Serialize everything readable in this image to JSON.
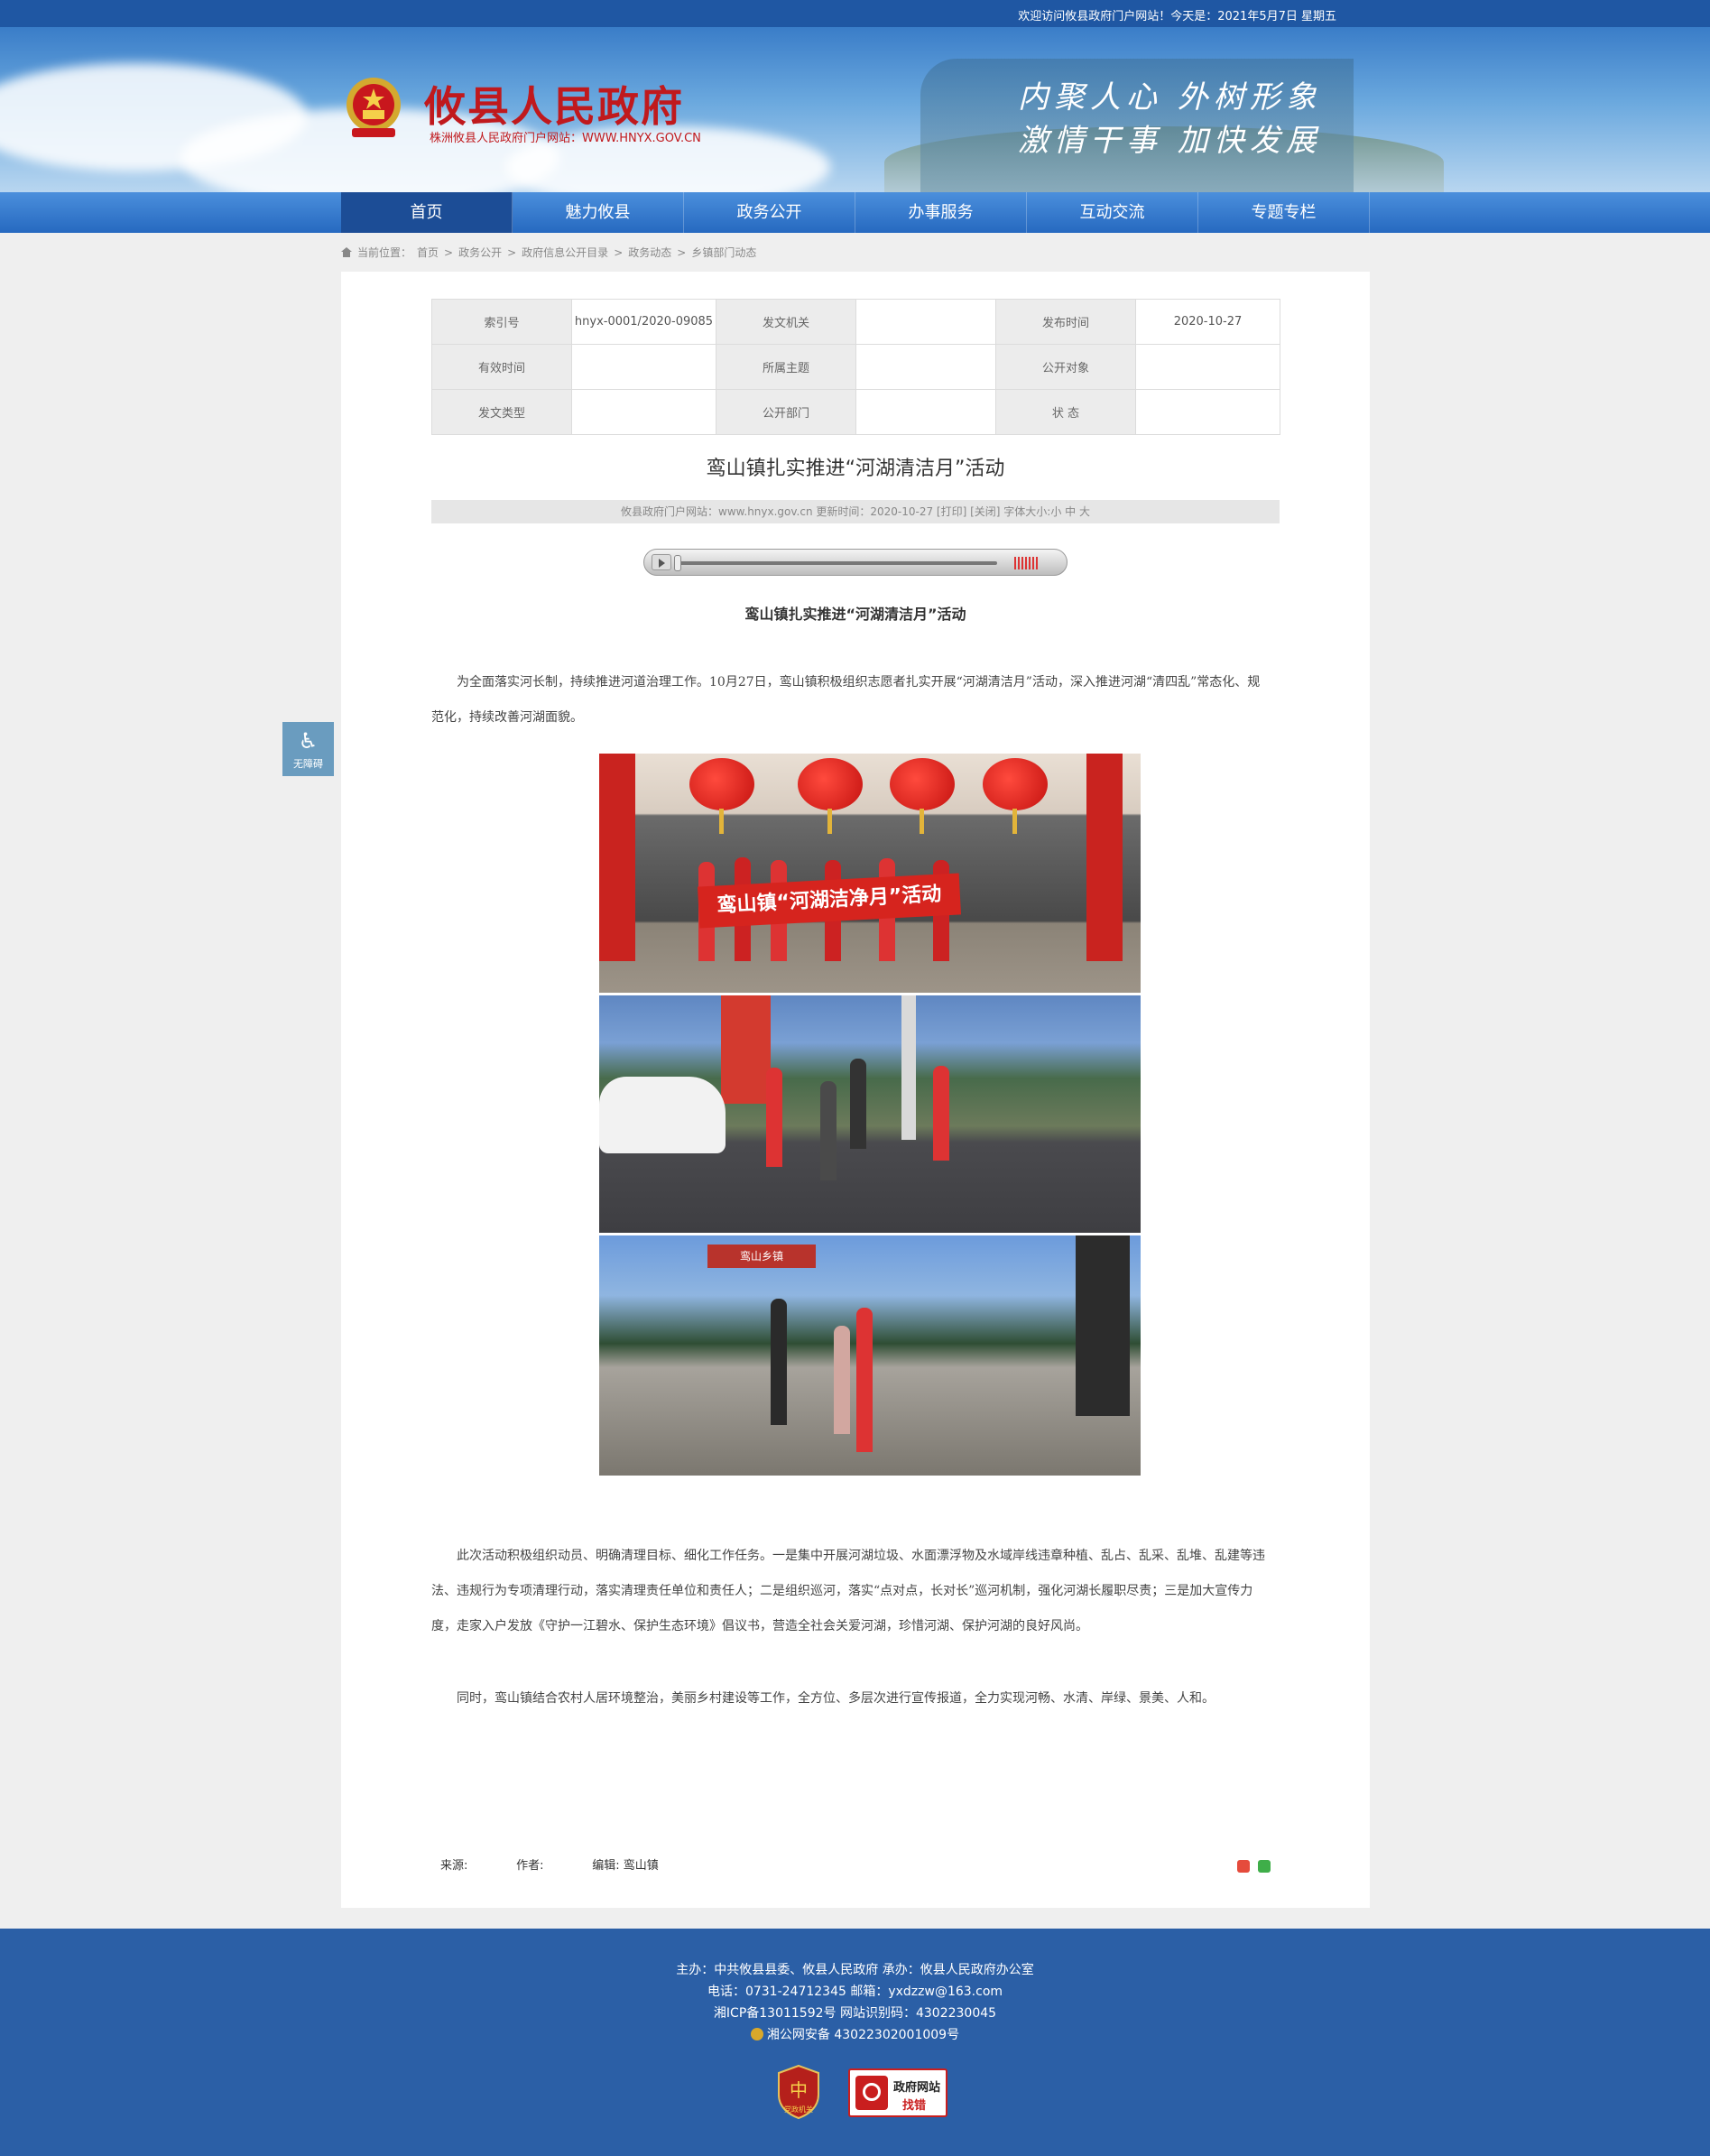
{
  "top_bar": {
    "welcome": "欢迎访问攸县政府门户网站！今天是：2021年5月7日 星期五"
  },
  "header": {
    "site_title": "攸县人民政府",
    "site_subtitle": "株洲攸县人民政府门户网站：WWW.HNYX.GOV.CN",
    "slogan_line1": "内聚人心  外树形象",
    "slogan_line2": "激情干事  加快发展"
  },
  "nav": {
    "items": [
      {
        "label": "首页",
        "active": true
      },
      {
        "label": "魅力攸县",
        "active": false
      },
      {
        "label": "政务公开",
        "active": false
      },
      {
        "label": "办事服务",
        "active": false
      },
      {
        "label": "互动交流",
        "active": false
      },
      {
        "label": "专题专栏",
        "active": false
      }
    ]
  },
  "breadcrumb": {
    "prefix": "当前位置：",
    "items": [
      "首页",
      "政务公开",
      "政府信息公开目录",
      "政务动态",
      "乡镇部门动态"
    ],
    "separator": ">"
  },
  "meta_table": {
    "rows": [
      [
        {
          "k": "索引号",
          "v": "hnyx-0001/2020-09085"
        },
        {
          "k": "发文机关",
          "v": ""
        },
        {
          "k": "发布时间",
          "v": "2020-10-27"
        }
      ],
      [
        {
          "k": "有效时间",
          "v": ""
        },
        {
          "k": "所属主题",
          "v": ""
        },
        {
          "k": "公开对象",
          "v": ""
        }
      ],
      [
        {
          "k": "发文类型",
          "v": ""
        },
        {
          "k": "公开部门",
          "v": ""
        },
        {
          "k": "状 态",
          "v": ""
        }
      ]
    ]
  },
  "article": {
    "title": "鸾山镇扎实推进“河湖清洁月”活动",
    "info_bar": "攸县政府门户网站：www.hnyx.gov.cn   更新时间：2020-10-27   [打印]   [关闭]   字体大小:小 中 大",
    "subheading": "鸾山镇扎实推进“河湖清洁月”活动",
    "para1": "为全面落实河长制，持续推进河道治理工作。10月27日，鸾山镇积极组织志愿者扎实开展“河湖清洁月”活动，深入推进河湖“清四乱”常态化、规范化，持续改善河湖面貌。",
    "photo_banner_text": "鸾山镇“河湖洁净月”活动",
    "photo_sign_text": "鸾山乡镇",
    "para2": "此次活动积极组织动员、明确清理目标、细化工作任务。一是集中开展河湖垃圾、水面漂浮物及水域岸线违章种植、乱占、乱采、乱堆、乱建等违法、违规行为专项清理行动，落实清理责任单位和责任人；二是组织巡河，落实“点对点，长对长”巡河机制，强化河湖长履职尽责；三是加大宣传力度，走家入户发放《守护一江碧水、保护生态环境》倡议书，营造全社会关爱河湖，珍惜河湖、保护河湖的良好风尚。",
    "para3": "同时，鸾山镇结合农村人居环境整治，美丽乡村建设等工作，全方位、多层次进行宣传报道，全力实现河畅、水清、岸绿、景美、人和。",
    "source_label": "来源:",
    "author_label": "作者:",
    "editor_label": "编辑:",
    "editor": "鸾山镇"
  },
  "accessibility": {
    "label": "无障碍",
    "icon": "wheelchair-icon"
  },
  "footer": {
    "line1": "主办：中共攸县县委、攸县人民政府 承办：攸县人民政府办公室",
    "line2": "电话：0731-24712345 邮箱：yxdzzw@163.com",
    "line3": "湘ICP备13011592号   网站识别码：4302230045",
    "line4": "湘公网安备 43022302001009号",
    "badge1_text": "党政机关",
    "badge2_line1": "政府网站",
    "badge2_line2": "找错"
  },
  "colors": {
    "brand_blue": "#1f57a3",
    "nav_active": "#1c4d96",
    "title_red": "#c0191d",
    "footer_blue": "#2b5fa6"
  }
}
